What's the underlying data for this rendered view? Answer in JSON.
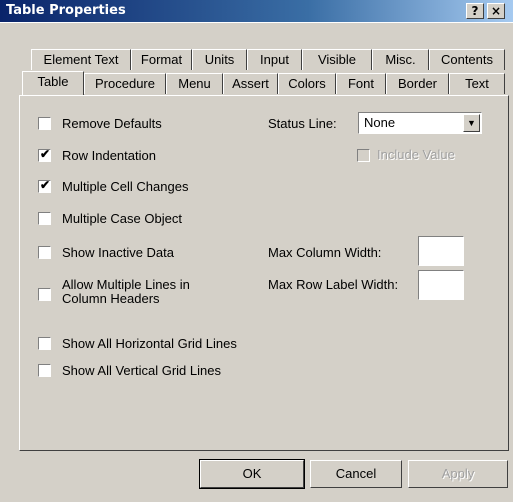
{
  "window": {
    "title": "Table Properties",
    "help_label": "?",
    "close_label": "×"
  },
  "tabs": {
    "row1": [
      "Element Text",
      "Format",
      "Units",
      "Input",
      "Visible",
      "Misc.",
      "Contents"
    ],
    "row2": [
      "Table",
      "Procedure",
      "Menu",
      "Assert",
      "Colors",
      "Font",
      "Border",
      "Text"
    ],
    "active": "Table"
  },
  "options": {
    "remove_defaults": {
      "label": "Remove Defaults",
      "checked": false
    },
    "row_indentation": {
      "label": "Row Indentation",
      "checked": true
    },
    "multiple_cell_changes": {
      "label": "Multiple Cell Changes",
      "checked": true
    },
    "multiple_case_object": {
      "label": "Multiple Case Object",
      "checked": false
    },
    "show_inactive_data": {
      "label": "Show Inactive Data",
      "checked": false
    },
    "allow_multiple_lines": {
      "label": "Allow Multiple Lines in Column Headers",
      "checked": false
    },
    "show_horizontal_grid": {
      "label": "Show All Horizontal Grid Lines",
      "checked": false
    },
    "show_vertical_grid": {
      "label": "Show All Vertical Grid Lines",
      "checked": false
    }
  },
  "status_line": {
    "label": "Status Line:",
    "value": "None",
    "include_value_label": "Include Value",
    "include_value_checked": false
  },
  "widths": {
    "max_column_width_label": "Max Column Width:",
    "max_column_width_value": "",
    "max_row_label_width_label": "Max Row Label Width:",
    "max_row_label_width_value": ""
  },
  "buttons": {
    "ok": "OK",
    "cancel": "Cancel",
    "apply": "Apply"
  }
}
